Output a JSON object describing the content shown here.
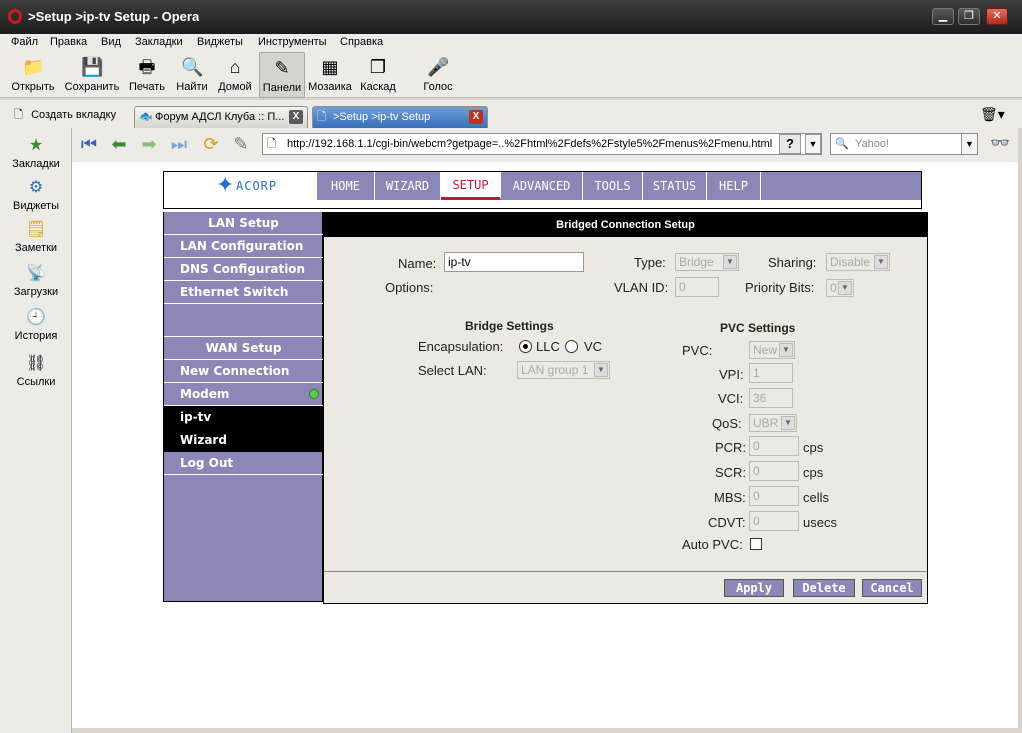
{
  "window": {
    "title": ">Setup >ip-tv Setup - Opera"
  },
  "menu": [
    "Файл",
    "Правка",
    "Вид",
    "Закладки",
    "Виджеты",
    "Инструменты",
    "Справка"
  ],
  "toolbar": [
    {
      "label": "Открыть",
      "icon": "folder-icon"
    },
    {
      "label": "Сохранить",
      "icon": "save-icon"
    },
    {
      "label": "Печать",
      "icon": "print-icon"
    },
    {
      "label": "Найти",
      "icon": "search-icon"
    },
    {
      "label": "Домой",
      "icon": "home-icon"
    },
    {
      "label": "Панели",
      "icon": "panels-icon"
    },
    {
      "label": "Мозаика",
      "icon": "tile-icon"
    },
    {
      "label": "Каскад",
      "icon": "cascade-icon"
    },
    {
      "label": "Голос",
      "icon": "voice-icon"
    }
  ],
  "tabs": {
    "new_tab": "Создать вкладку",
    "items": [
      {
        "label": "Форум АДСЛ Клуба :: П..."
      },
      {
        "label": ">Setup >ip-tv Setup"
      }
    ]
  },
  "panels": [
    "Закладки",
    "Виджеты",
    "Заметки",
    "Загрузки",
    "История",
    "Ссылки"
  ],
  "address": {
    "url": "http://192.168.1.1/cgi-bin/webcm?getpage=..%2Fhtml%2Fdefs%2Fstyle5%2Fmenus%2Fmenu.html",
    "search_placeholder": "Yahoo!"
  },
  "router": {
    "logo": "ACORP",
    "nav": [
      "HOME",
      "WIZARD",
      "SETUP",
      "ADVANCED",
      "TOOLS",
      "STATUS",
      "HELP"
    ],
    "selected_nav": "SETUP",
    "sidebar": [
      "LAN Setup",
      "LAN Configuration",
      "DNS Configuration",
      "Ethernet Switch",
      "WAN Setup",
      "New Connection",
      "Modem",
      "ip-tv",
      "Wizard",
      "Log Out"
    ],
    "panel_title": "Bridged Connection Setup",
    "form": {
      "name_label": "Name:",
      "name_value": "ip-tv",
      "type_label": "Type:",
      "type_value": "Bridge",
      "sharing_label": "Sharing:",
      "sharing_value": "Disable",
      "options_label": "Options:",
      "vlan_label": "VLAN ID:",
      "vlan_value": "0",
      "priority_label": "Priority Bits:",
      "priority_value": "0",
      "bridge_title": "Bridge Settings",
      "encap_label": "Encapsulation:",
      "encap_llc": "LLC",
      "encap_vc": "VC",
      "select_lan_label": "Select LAN:",
      "select_lan_value": "LAN group 1",
      "pvc_title": "PVC Settings",
      "pvc_label": "PVC:",
      "pvc_value": "New",
      "vpi_label": "VPI:",
      "vpi_value": "1",
      "vci_label": "VCI:",
      "vci_value": "36",
      "qos_label": "QoS:",
      "qos_value": "UBR",
      "pcr_label": "PCR:",
      "pcr_value": "0",
      "pcr_unit": "cps",
      "scr_label": "SCR:",
      "scr_value": "0",
      "scr_unit": "cps",
      "mbs_label": "MBS:",
      "mbs_value": "0",
      "mbs_unit": "cells",
      "cdvt_label": "CDVT:",
      "cdvt_value": "0",
      "cdvt_unit": "usecs",
      "auto_pvc_label": "Auto PVC:"
    },
    "buttons": [
      "Apply",
      "Delete",
      "Cancel"
    ]
  }
}
